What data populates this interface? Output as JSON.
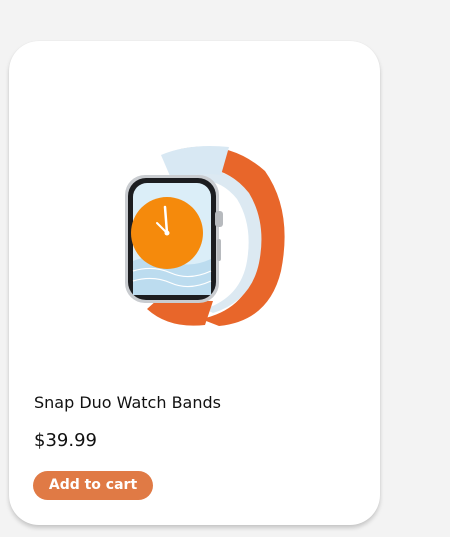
{
  "product": {
    "title": "Snap Duo Watch Bands",
    "price": "$39.99",
    "image_icon": "smartwatch-orange-band-icon"
  },
  "actions": {
    "add_to_cart_label": "Add to cart"
  },
  "colors": {
    "card_background": "#ffffff",
    "page_background": "#f3f3f3",
    "button_background": "#e07a45",
    "button_text": "#ffffff",
    "band_orange": "#e8662a",
    "band_light_blue": "#d8e8f3",
    "watch_face_orange": "#f58a0c"
  }
}
